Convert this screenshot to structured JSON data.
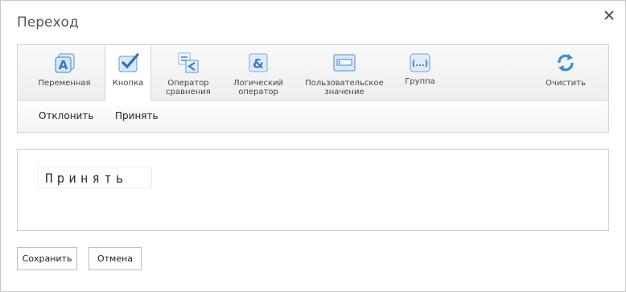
{
  "dialog": {
    "title": "Переход"
  },
  "ribbon": {
    "tabs": [
      {
        "label": "Переменная",
        "icon": "variable-icon"
      },
      {
        "label": "Кнопка",
        "icon": "button-icon"
      },
      {
        "label": "Оператор\nсравнения",
        "icon": "comparison-operator-icon"
      },
      {
        "label": "Логический\nоператор",
        "icon": "logical-operator-icon"
      },
      {
        "label": "Пользовательское\nзначение",
        "icon": "custom-value-icon"
      },
      {
        "label": "Группа",
        "icon": "group-icon"
      },
      {
        "label": "Очистить",
        "icon": "refresh-icon"
      }
    ],
    "active_tab": "Кнопка",
    "toolbar": {
      "reject_label": "Отклонить",
      "accept_label": "Принять"
    }
  },
  "content": {
    "chip_text": "Принять"
  },
  "footer": {
    "save_label": "Сохранить",
    "cancel_label": "Отмена"
  },
  "colors": {
    "icon_blue": "#3a8fd6",
    "icon_light": "#dcebf8"
  }
}
